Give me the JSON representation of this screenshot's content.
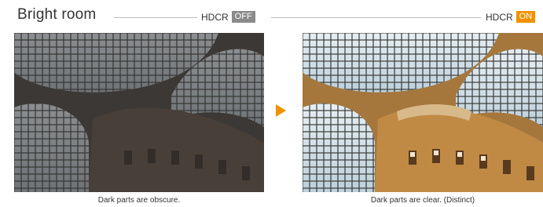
{
  "title": "Bright room",
  "off_panel": {
    "label": "HDCR",
    "badge": "OFF",
    "badge_color": "#8a8a8a",
    "caption": "Dark parts are obscure."
  },
  "on_panel": {
    "label": "HDCR",
    "badge": "ON",
    "badge_color": "#f29100",
    "caption": "Dark parts are clear. (Distinct)"
  },
  "arrow_color": "#f29100"
}
